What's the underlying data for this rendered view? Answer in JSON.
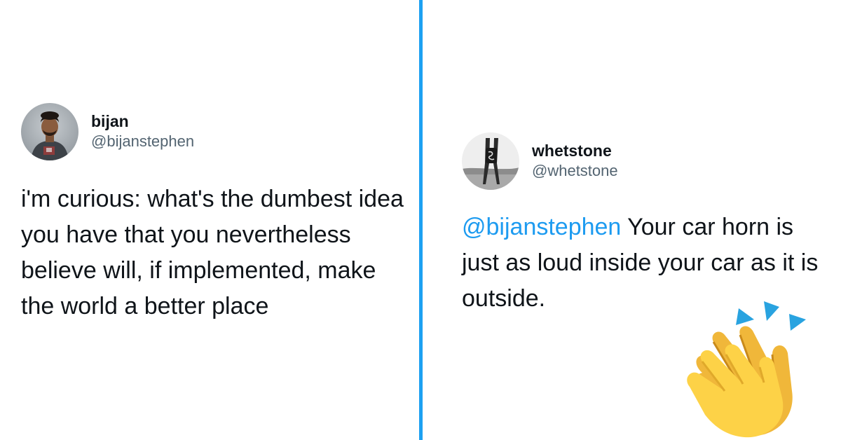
{
  "colors": {
    "divider": "#1da1f2",
    "mention": "#1d9bf0",
    "handle": "#536471",
    "text": "#0f1419"
  },
  "left_tweet": {
    "display_name": "bijan",
    "handle": "@bijanstephen",
    "text": "i'm curious: what's the dumbest idea you have that you nevertheless believe will, if implemented, make the world a better place"
  },
  "right_tweet": {
    "display_name": "whetstone",
    "handle": "@whetstone",
    "mention": "@bijanstephen",
    "text": " Your car horn is just as loud inside your car as it is outside."
  },
  "emoji": {
    "name": "clapping-hands-icon"
  }
}
